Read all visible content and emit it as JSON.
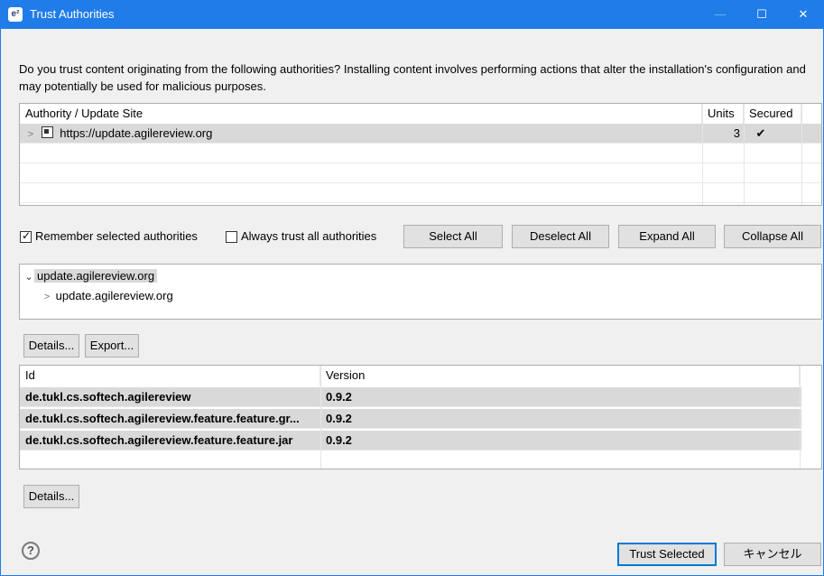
{
  "window": {
    "app_icon_glyph": "e²",
    "title": "Trust Authorities",
    "minimize": "—",
    "maximize": "☐",
    "close": "✕"
  },
  "message": "Do you trust content originating from the following authorities?  Installing content involves performing actions that alter the installation's configuration and may potentially be used for malicious purposes.",
  "authorities": {
    "columns": {
      "site": "Authority / Update Site",
      "units": "Units",
      "secured": "Secured"
    },
    "rows": [
      {
        "site": "https://update.agilereview.org",
        "units": "3",
        "secured": "✔"
      }
    ]
  },
  "options": {
    "remember_label": "Remember selected authorities",
    "remember_checked": "✓",
    "always_label": "Always trust all authorities"
  },
  "buttons": {
    "select_all": "Select All",
    "deselect_all": "Deselect All",
    "expand_all": "Expand All",
    "collapse_all": "Collapse All",
    "details_top": "Details...",
    "export": "Export...",
    "details_bottom": "Details...",
    "trust_selected": "Trust Selected",
    "cancel": "キャンセル"
  },
  "tree": {
    "root": "update.agilereview.org",
    "child": "update.agilereview.org"
  },
  "units": {
    "columns": {
      "id": "Id",
      "version": "Version"
    },
    "rows": [
      {
        "id": "de.tukl.cs.softech.agilereview",
        "version": "0.9.2"
      },
      {
        "id": "de.tukl.cs.softech.agilereview.feature.feature.gr...",
        "version": "0.9.2"
      },
      {
        "id": "de.tukl.cs.softech.agilereview.feature.feature.jar",
        "version": "0.9.2"
      }
    ]
  },
  "help_glyph": "?",
  "colors": {
    "titlebar": "#1f7ce8",
    "default_button_border": "#0078d7",
    "selected_row": "#d9d9d9"
  }
}
